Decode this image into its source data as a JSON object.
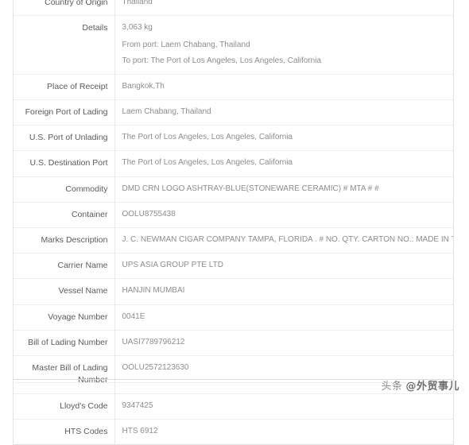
{
  "card": {
    "rows": [
      {
        "label": "Country of Origin",
        "value": "Thailand",
        "name": "country-of-origin",
        "clipped": true
      },
      {
        "label": "Details",
        "name": "details",
        "lines": [
          "3,063 kg",
          "From port: Laem Chabang, Thailand",
          "To port: The Port of Los Angeles, Los Angeles, California"
        ]
      },
      {
        "label": "Place of Receipt",
        "value": "Bangkok,Th",
        "name": "place-of-receipt"
      },
      {
        "label": "Foreign Port of Lading",
        "value": "Laem Chabang, Thailand",
        "name": "foreign-port-of-lading"
      },
      {
        "label": "U.S. Port of Unlading",
        "value": "The Port of Los Angeles, Los Angeles, California",
        "name": "us-port-of-unlading"
      },
      {
        "label": "U.S. Destination Port",
        "value": "The Port of Los Angeles, Los Angeles, California",
        "name": "us-destination-port"
      },
      {
        "label": "Commodity",
        "value": "DMD CRN LOGO ASHTRAY-BLUE(STONEWARE CERAMIC) # MTA # #",
        "name": "commodity"
      },
      {
        "label": "Container",
        "value": "OOLU8755438",
        "name": "container"
      },
      {
        "label": "Marks Description",
        "value": "J. C. NEWMAN CIGAR COMPANY TAMPA, FLORIDA . # NO. QTY. CARTON NO.: MADE IN THAILAND",
        "name": "marks-description"
      },
      {
        "label": "Carrier Name",
        "value": "UPS ASIA GROUP PTE LTD",
        "name": "carrier-name"
      },
      {
        "label": "Vessel Name",
        "value": "HANJIN MUMBAI",
        "name": "vessel-name"
      },
      {
        "label": "Voyage Number",
        "value": "0041E",
        "name": "voyage-number"
      },
      {
        "label": "Bill of Lading Number",
        "value": "UASI7789796212",
        "name": "bill-of-lading-number"
      },
      {
        "label": "Master Bill of Lading Number",
        "value": "OOLU2572123630",
        "name": "master-bill-of-lading-number"
      },
      {
        "label": "Lloyd's Code",
        "value": "9347425",
        "name": "lloyds-code"
      },
      {
        "label": "HTS Codes",
        "value": "HTS 6912",
        "name": "hts-codes"
      }
    ]
  },
  "watermark": {
    "brand": "头条",
    "handle": "@外贸事儿"
  }
}
